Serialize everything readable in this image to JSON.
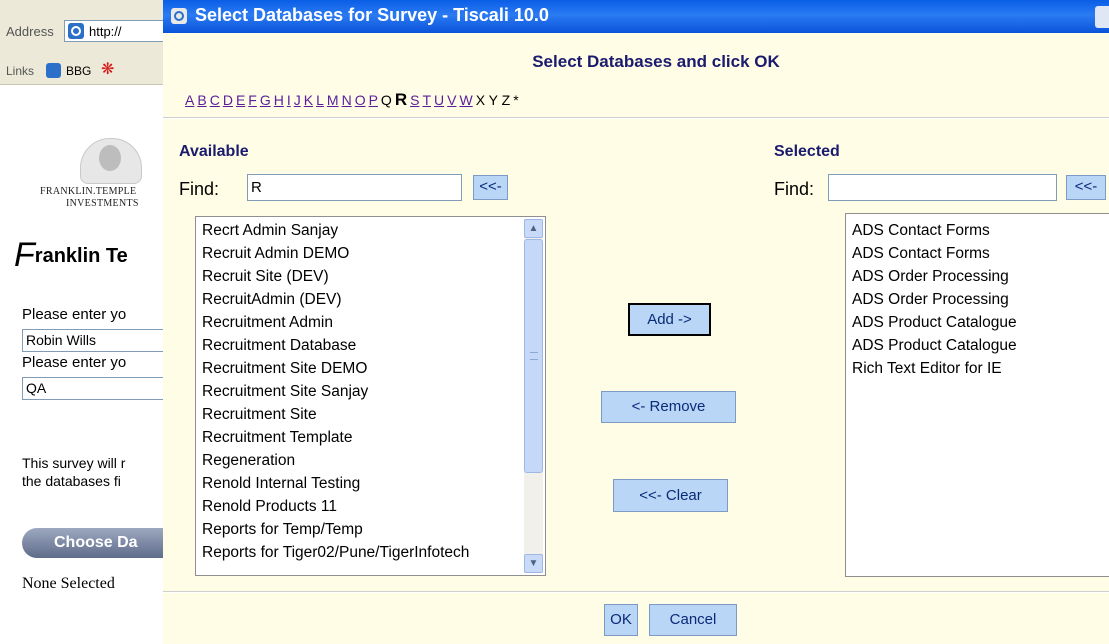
{
  "background": {
    "address_label": "Address",
    "address_url": "http://",
    "links_label": "Links",
    "links_bbg": "BBG",
    "company_line1": "FRANKLIN.TEMPLE",
    "company_line2": "INVESTMENTS",
    "heading_initial": "F",
    "heading_rest": "ranklin Te",
    "prompt1": "Please enter yo",
    "value1": "Robin Wills",
    "prompt2": "Please enter yo",
    "value2": "QA",
    "note_line1": "This survey will r",
    "note_line2": "the databases fi",
    "choose_button": "Choose Da",
    "none_selected": "None Selected"
  },
  "dialog": {
    "title": "Select Databases for Survey - Tiscali 10.0",
    "header": "Select Databases and click OK",
    "alphabet": {
      "links": [
        "A",
        "B",
        "C",
        "D",
        "E",
        "F",
        "G",
        "H",
        "I",
        "J",
        "K",
        "L",
        "M",
        "N",
        "O",
        "P"
      ],
      "plain_before": "Q",
      "current": "R",
      "links_after": [
        "S",
        "T",
        "U",
        "V",
        "W"
      ],
      "plain_after": "X Y Z",
      "star": "*"
    },
    "available": {
      "title": "Available",
      "find_label": "Find:",
      "find_value": "R",
      "find_button": "<<-",
      "items": [
        "Recrt Admin Sanjay",
        "Recruit Admin DEMO",
        "Recruit Site (DEV)",
        "RecruitAdmin (DEV)",
        "Recruitment Admin",
        "Recruitment Database",
        "Recruitment Site DEMO",
        "Recruitment Site Sanjay",
        "Recruitment Site",
        "Recruitment Template",
        "Regeneration",
        "Renold Internal Testing",
        "Renold Products 11",
        "Reports for Temp/Temp",
        "Reports for Tiger02/Pune/TigerInfotech"
      ]
    },
    "selected": {
      "title": "Selected",
      "find_label": "Find:",
      "find_value": "",
      "find_button": "<<-",
      "items": [
        "ADS Contact Forms",
        "ADS Contact Forms",
        "ADS Order Processing",
        "ADS Order Processing",
        "ADS Product Catalogue",
        "ADS Product Catalogue",
        "Rich Text Editor for IE"
      ]
    },
    "buttons": {
      "add": "Add ->",
      "remove": "<- Remove",
      "clear": "<<- Clear",
      "ok": "OK",
      "cancel": "Cancel"
    }
  }
}
